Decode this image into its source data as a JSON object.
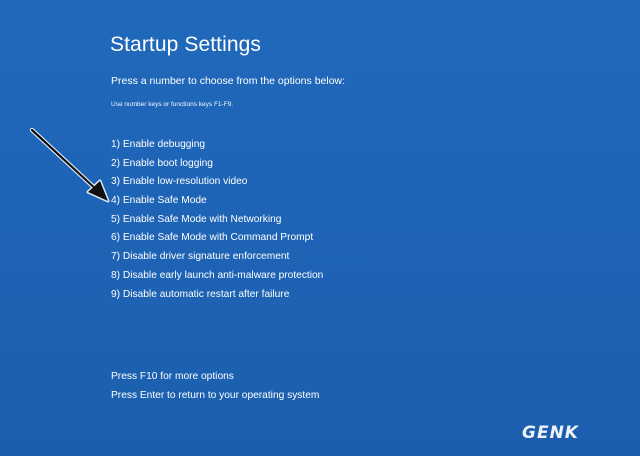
{
  "screen": {
    "title": "Startup Settings",
    "instruction": "Press a number to choose from the options below:",
    "hint": "Use number keys or functions keys F1-F9."
  },
  "options": [
    "1) Enable debugging",
    "2) Enable boot logging",
    "3) Enable low-resolution video",
    "4) Enable Safe Mode",
    "5) Enable Safe Mode with Networking",
    "6) Enable Safe Mode with Command Prompt",
    "7) Disable driver signature enforcement",
    "8) Disable early launch anti-malware protection",
    "9) Disable automatic restart after failure"
  ],
  "footer": {
    "more_options": "Press F10 for more options",
    "return": "Press Enter to return to your operating system"
  },
  "watermark": {
    "text": "GENK"
  },
  "annotation": {
    "icon": "arrow-pointer-icon",
    "points_to_option": 4
  },
  "colors": {
    "background": "#1f63b5",
    "text": "#ffffff",
    "arrow": "#111111"
  }
}
